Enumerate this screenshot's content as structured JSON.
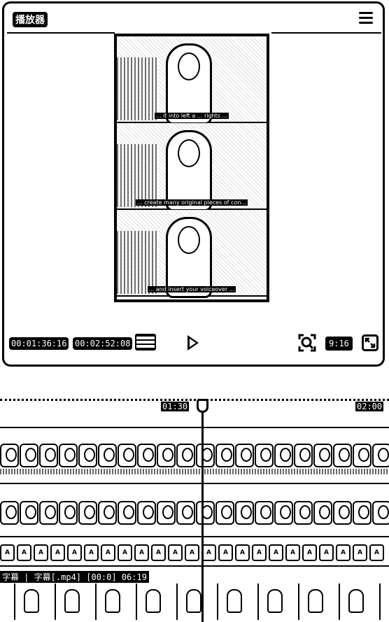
{
  "player": {
    "title": "播放器",
    "menu_icon": "hamburger-menu-icon",
    "captions": [
      "... it into left a ... rights ...",
      "... create many original pieces of con...",
      "... and insert your voiceover ..."
    ],
    "current_time": "00:01:36:16",
    "total_time": "00:02:52:08",
    "aspect_ratio": "9:16",
    "icons": {
      "list": "frame-list-icon",
      "play": "play-icon",
      "zoom": "zoom-icon",
      "fullscreen": "fullscreen-icon"
    }
  },
  "timeline": {
    "ticks": [
      "01:30",
      "02:00"
    ],
    "clip_label": "字幕 | 字幕[.mp4] [00:0] 06:19"
  }
}
